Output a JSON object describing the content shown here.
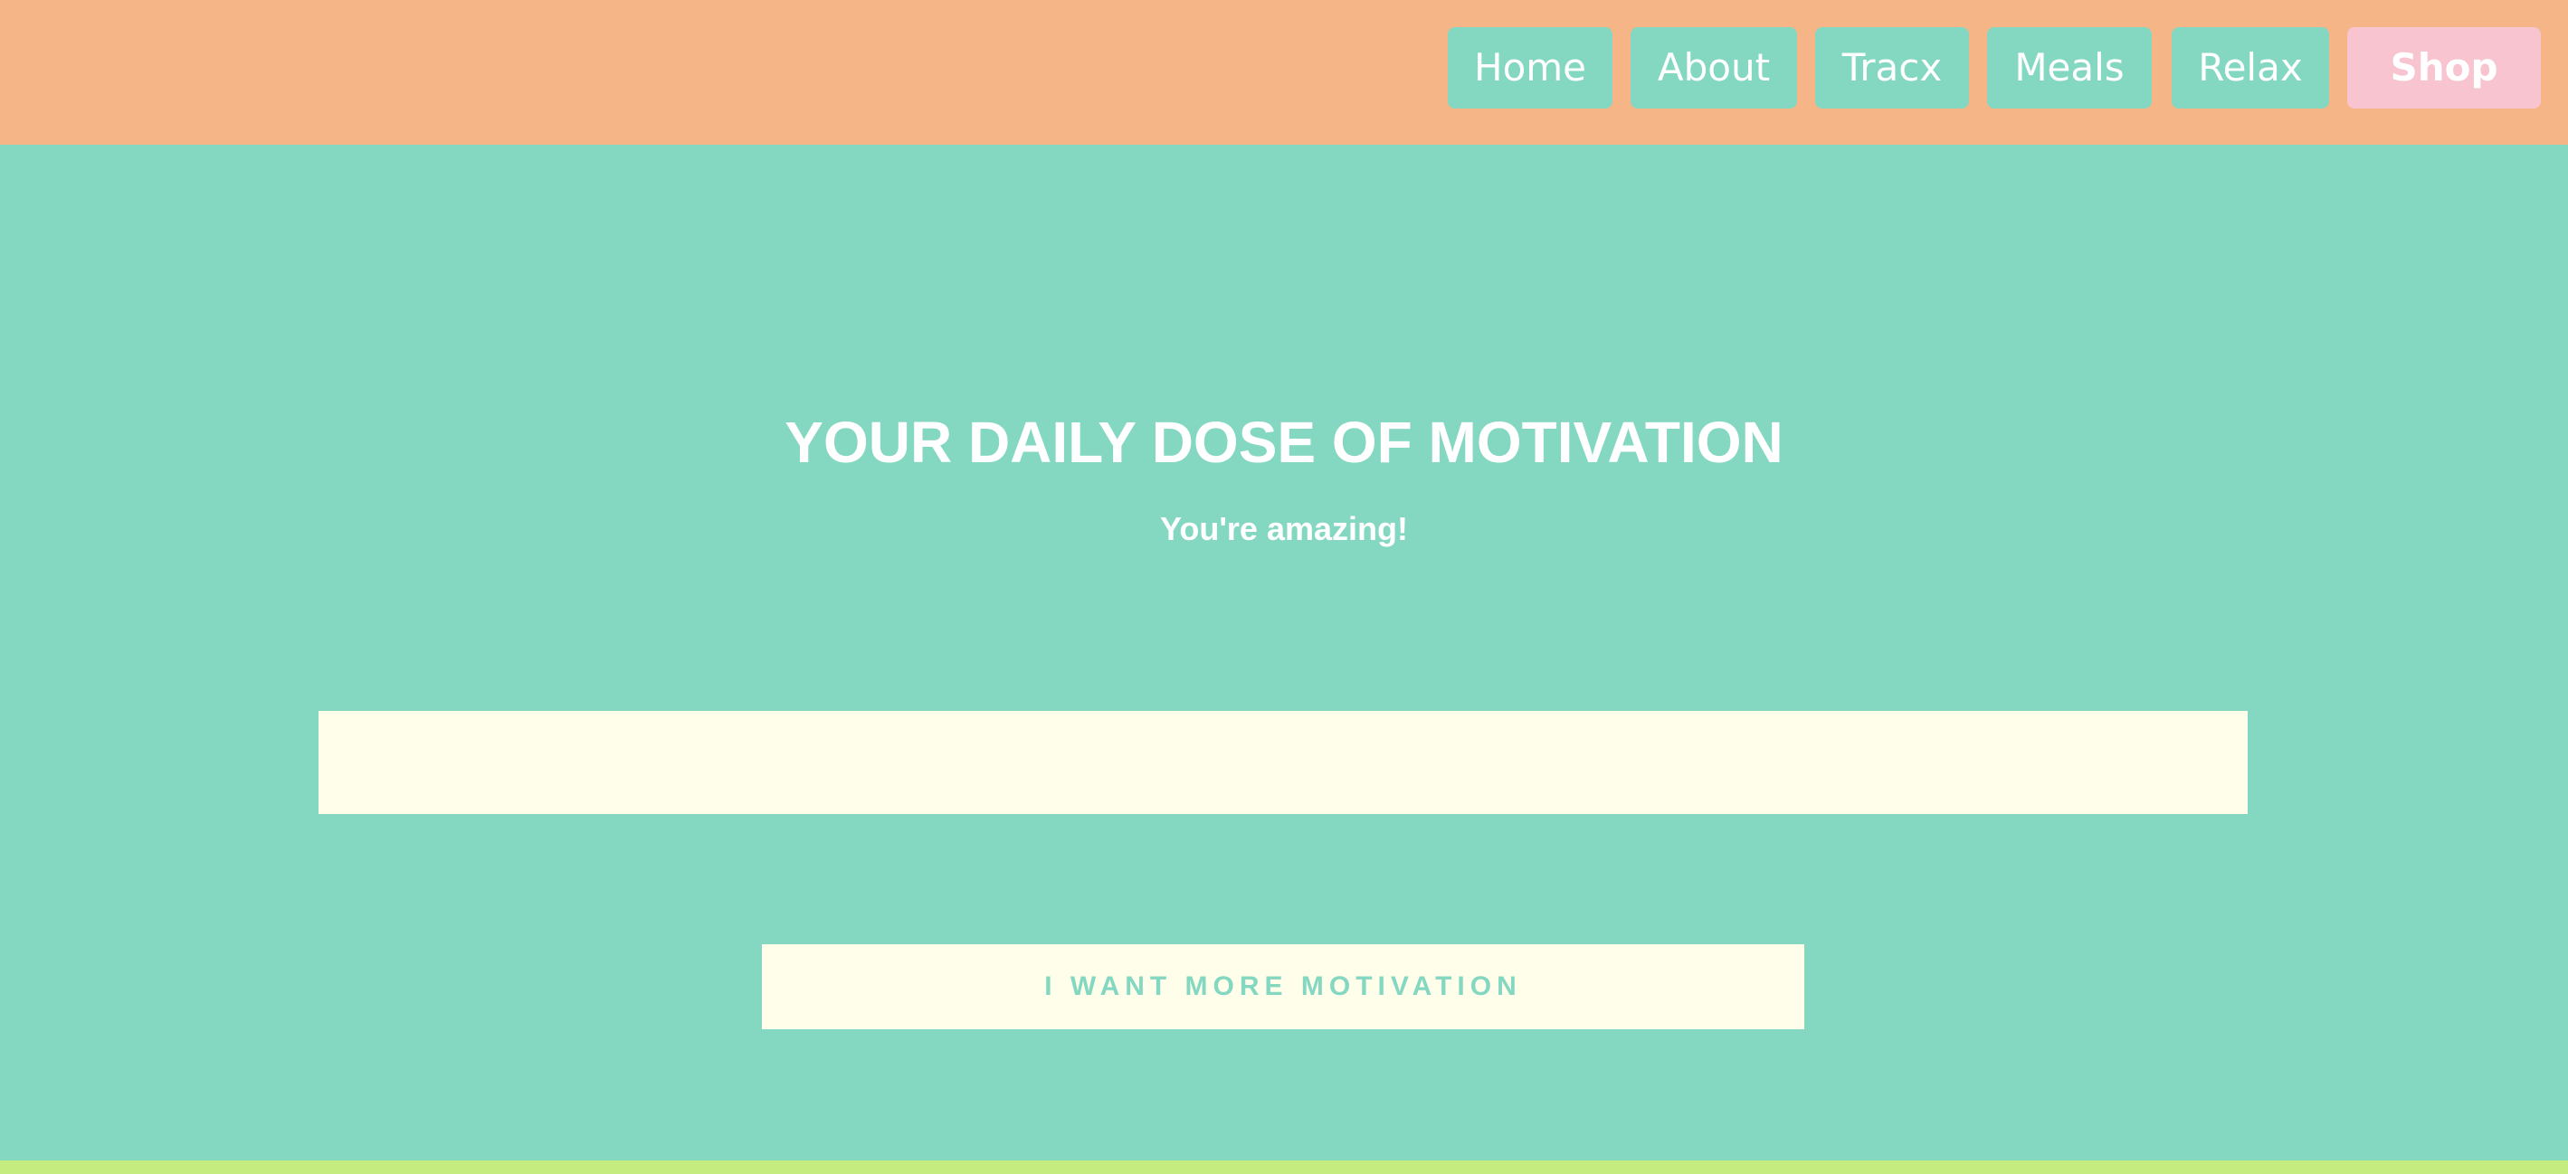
{
  "colors": {
    "header_bg": "#f6b587",
    "page_bg": "#84d8c2",
    "nav_button_bg": "#84d8c2",
    "shop_button_bg": "#f7c4d0",
    "panel_bg": "#fffeea",
    "accent_text": "#84d8c2",
    "bottom_strip": "#c5ec7f"
  },
  "nav": {
    "items": [
      {
        "label": "Home"
      },
      {
        "label": "About"
      },
      {
        "label": "Tracx"
      },
      {
        "label": "Meals"
      },
      {
        "label": "Relax"
      },
      {
        "label": "Shop"
      }
    ]
  },
  "hero": {
    "title": "YOUR DAILY DOSE OF MOTIVATION",
    "subtitle": "You're amazing!"
  },
  "quote": {
    "text": ""
  },
  "cta": {
    "label": "I WANT MORE MOTIVATION"
  }
}
